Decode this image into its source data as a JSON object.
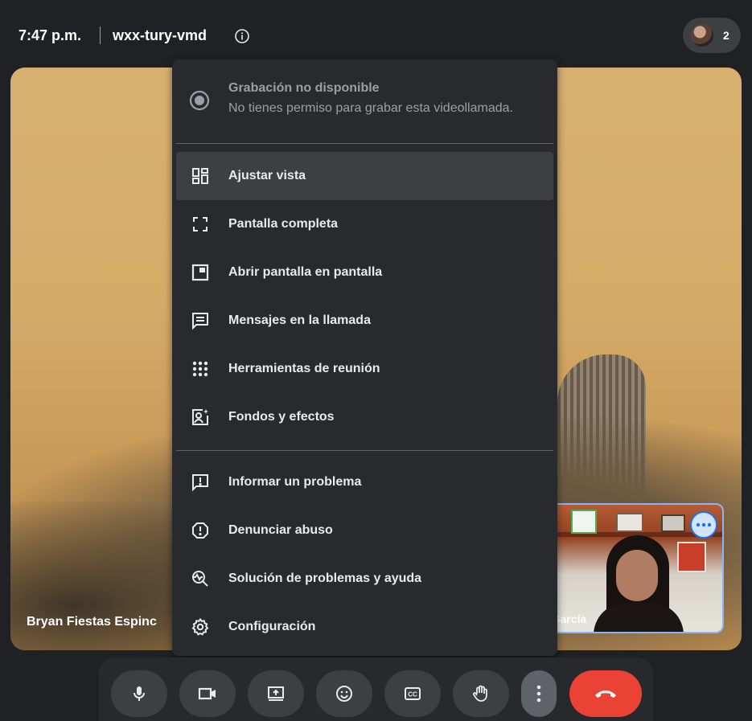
{
  "header": {
    "time": "7:47 p.m.",
    "meeting_code": "wxx-tury-vmd",
    "participant_count": "2"
  },
  "main_video": {
    "participant_name": "Bryan Fiestas Espinc"
  },
  "self_view": {
    "participant_name": "el García"
  },
  "menu": {
    "recording_title": "Grabación no disponible",
    "recording_subtitle": "No tienes permiso para grabar esta videollamada.",
    "items": [
      {
        "label": "Ajustar vista",
        "icon": "layout-icon"
      },
      {
        "label": "Pantalla completa",
        "icon": "fullscreen-icon"
      },
      {
        "label": "Abrir pantalla en pantalla",
        "icon": "picture-in-picture-icon"
      },
      {
        "label": "Mensajes en la llamada",
        "icon": "chat-icon"
      },
      {
        "label": "Herramientas de reunión",
        "icon": "apps-grid-icon"
      },
      {
        "label": "Fondos y efectos",
        "icon": "effects-icon"
      },
      {
        "label": "Informar un problema",
        "icon": "feedback-icon"
      },
      {
        "label": "Denunciar abuso",
        "icon": "report-icon"
      },
      {
        "label": "Solución de problemas y ayuda",
        "icon": "troubleshoot-icon"
      },
      {
        "label": "Configuración",
        "icon": "settings-icon"
      }
    ]
  },
  "controls": [
    {
      "name": "microphone",
      "icon": "mic-icon"
    },
    {
      "name": "camera",
      "icon": "camera-icon"
    },
    {
      "name": "present",
      "icon": "present-screen-icon"
    },
    {
      "name": "reactions",
      "icon": "emoji-icon"
    },
    {
      "name": "captions",
      "icon": "captions-icon"
    },
    {
      "name": "raise-hand",
      "icon": "hand-icon"
    },
    {
      "name": "more-options",
      "icon": "more-vert-icon"
    },
    {
      "name": "leave-call",
      "icon": "hang-up-icon"
    }
  ],
  "colors": {
    "background": "#202124",
    "menu": "#292a2d",
    "end_call": "#ea4335",
    "active_item": "#3c4043"
  }
}
